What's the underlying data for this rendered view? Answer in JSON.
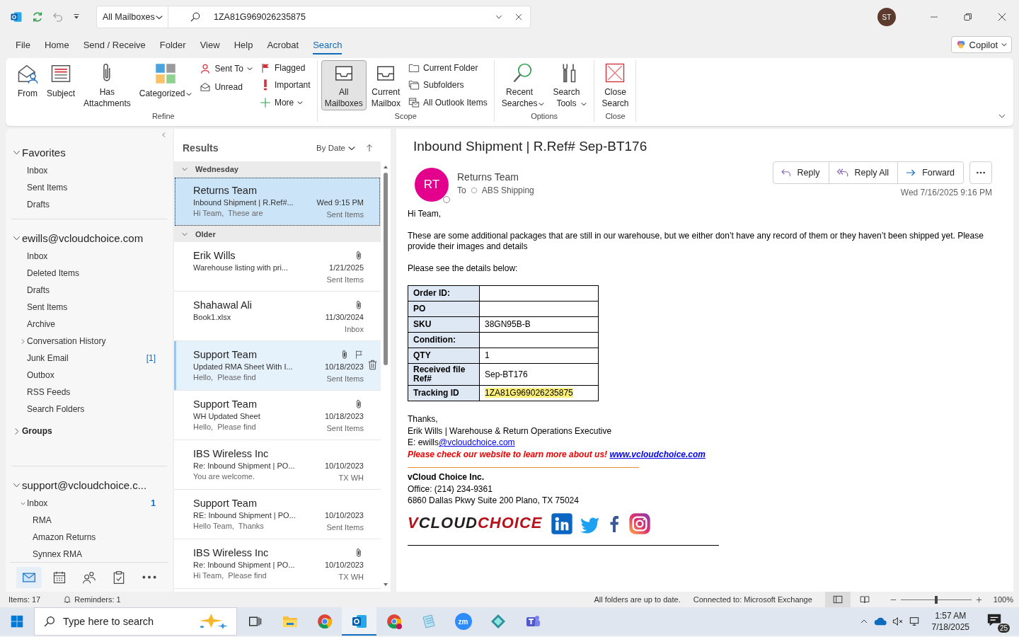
{
  "title_bar": {
    "scope": "All Mailboxes",
    "search": {
      "value": "1ZA81G969026235875"
    },
    "account_initials": "ST"
  },
  "menu_tabs": [
    {
      "label": "File",
      "selected": false
    },
    {
      "label": "Home",
      "selected": false
    },
    {
      "label": "Send / Receive",
      "selected": false
    },
    {
      "label": "Folder",
      "selected": false
    },
    {
      "label": "View",
      "selected": false
    },
    {
      "label": "Help",
      "selected": false
    },
    {
      "label": "Acrobat",
      "selected": false
    },
    {
      "label": "Search",
      "selected": true
    }
  ],
  "copilot": {
    "label": "Copilot"
  },
  "ribbon_groups": [
    {
      "label": "Refine",
      "columns": [
        {
          "kind": "large",
          "label": "From",
          "selected": false
        },
        {
          "kind": "large",
          "label": "Subject",
          "selected": false
        },
        {
          "kind": "large",
          "label": "Has Attachments",
          "selected": false
        },
        {
          "kind": "large",
          "label": "Categorized",
          "selected": false,
          "dropdown": true
        },
        {
          "kind": "stack",
          "buttons": [
            {
              "label": "Sent To",
              "dropdown": true
            },
            {
              "label": "Unread"
            }
          ]
        },
        {
          "kind": "stack",
          "buttons": [
            {
              "label": "Flagged"
            },
            {
              "label": "Important"
            },
            {
              "label": "More",
              "dropdown": true
            }
          ]
        }
      ]
    },
    {
      "label": "Scope",
      "columns": [
        {
          "kind": "large",
          "label": "All Mailboxes",
          "selected": true
        },
        {
          "kind": "large",
          "label": "Current Mailbox",
          "selected": false
        },
        {
          "kind": "stack",
          "buttons": [
            {
              "label": "Current Folder"
            },
            {
              "label": "Subfolders"
            },
            {
              "label": "All Outlook Items"
            }
          ]
        }
      ]
    },
    {
      "label": "Options",
      "columns": [
        {
          "kind": "large",
          "label": "Recent Searches",
          "selected": false,
          "dropdown": true
        },
        {
          "kind": "large",
          "label": "Search Tools",
          "selected": false,
          "dropdown": true
        }
      ]
    },
    {
      "label": "Close",
      "columns": [
        {
          "kind": "large",
          "label": "Close Search",
          "selected": false
        }
      ]
    }
  ],
  "nav": [
    {
      "kind": "account",
      "label": "Favorites",
      "expanded": true,
      "children": [
        {
          "label": "Inbox"
        },
        {
          "label": "Sent Items"
        },
        {
          "label": "Drafts"
        }
      ]
    },
    {
      "kind": "account",
      "label": "ewills@vcloudchoice.com",
      "expanded": true,
      "children": [
        {
          "label": "Inbox"
        },
        {
          "label": "Deleted Items"
        },
        {
          "label": "Drafts"
        },
        {
          "label": "Sent Items"
        },
        {
          "label": "Archive"
        },
        {
          "label": "Conversation History",
          "expanded": false
        },
        {
          "label": "Junk Email",
          "count": "[1]"
        },
        {
          "label": "Outbox"
        },
        {
          "label": "RSS Feeds"
        },
        {
          "label": "Search Folders"
        }
      ]
    },
    {
      "kind": "group",
      "label": "Groups",
      "expanded": false
    },
    {
      "kind": "account",
      "label": "support@vcloudchoice.c...",
      "expanded": true,
      "children": [
        {
          "label": "Inbox",
          "expanded": true,
          "count": "1",
          "children": [
            {
              "label": "RMA"
            },
            {
              "label": "Amazon Returns"
            },
            {
              "label": "Synnex RMA"
            }
          ]
        }
      ]
    }
  ],
  "module_switcher": [
    {
      "selected": true
    },
    {
      "selected": false
    },
    {
      "selected": false
    },
    {
      "selected": false
    },
    {
      "selected": false
    }
  ],
  "message_list": {
    "title": "Results",
    "sort": "By Date",
    "groups": [
      {
        "label": "Wednesday",
        "expanded": true,
        "messages": [
          {
            "sender": "Returns Team",
            "subject": "Inbound Shipment | R.Ref#...",
            "preview": "Hi Team,  These are",
            "date": "Wed 9:15 PM",
            "folder": "Sent Items",
            "attachment": false,
            "selected": true,
            "hovered": false
          }
        ]
      },
      {
        "label": "Older",
        "expanded": true,
        "messages": [
          {
            "sender": "Erik Wills",
            "subject": "Warehouse listing with pri...",
            "date": "1/21/2025",
            "folder": "Sent Items",
            "attachment": true,
            "selected": false,
            "hovered": false
          },
          {
            "sender": "Shahawal Ali",
            "subject": "Book1.xlsx",
            "date": "11/30/2024",
            "folder": "Inbox",
            "attachment": true,
            "selected": false,
            "hovered": false
          },
          {
            "sender": "Support Team",
            "subject": "Updated RMA Sheet With I...",
            "preview": "Hello,  Please find",
            "date": "10/18/2023",
            "folder": "Sent Items",
            "attachment": true,
            "selected": false,
            "hovered": true
          },
          {
            "sender": "Support Team",
            "subject": "WH Updated Sheet",
            "preview": "Hello,  Please find",
            "date": "10/18/2023",
            "folder": "Sent Items",
            "attachment": true,
            "selected": false,
            "hovered": false
          },
          {
            "sender": "IBS Wireless Inc",
            "subject": "Re: Inbound Shipment | PO...",
            "preview": "You are welcome.",
            "date": "10/10/2023",
            "folder": "TX WH",
            "attachment": false,
            "selected": false,
            "hovered": false
          },
          {
            "sender": "Support Team",
            "subject": "RE: Inbound Shipment | PO...",
            "preview": "Hello Team,  Thanks",
            "date": "10/10/2023",
            "folder": "Sent Items",
            "attachment": false,
            "selected": false,
            "hovered": false
          },
          {
            "sender": "IBS Wireless Inc",
            "subject": "Re: Inbound Shipment | PO...",
            "preview": "Hi Team,  Please find",
            "date": "10/10/2023",
            "folder": "TX WH",
            "attachment": true,
            "selected": false,
            "hovered": false
          }
        ]
      }
    ]
  },
  "reading_pane": {
    "subject": "Inbound Shipment | R.Ref# Sep-BT176",
    "sender_initials": "RT",
    "sender": "Returns Team",
    "to_label": "To",
    "recipient": "ABS Shipping",
    "actions": [
      {
        "label": "Reply"
      },
      {
        "label": "Reply All"
      },
      {
        "label": "Forward"
      }
    ],
    "date": "Wed 7/16/2025 9:16 PM",
    "body": {
      "greeting": "Hi Team,",
      "paragraph": "These are some additional packages that are still in our warehouse, but we either don’t have any record of them or they haven’t been shipped yet. Please provide their images and details",
      "intro": "Please see the details below:",
      "table": [
        {
          "label": "Order ID:",
          "highlighted": false
        },
        {
          "label": "PO",
          "highlighted": false
        },
        {
          "label": "SKU",
          "value": "38GN95B-B",
          "highlighted": false
        },
        {
          "label": "Condition:",
          "highlighted": false
        },
        {
          "label": "QTY",
          "value": "1",
          "highlighted": false
        },
        {
          "label": "Received file Ref#",
          "value": "Sep-BT176",
          "highlighted": false
        },
        {
          "label": "Tracking ID",
          "value": "1ZA81G969026235875",
          "highlighted": true
        }
      ],
      "signoff": "Thanks,",
      "signature_name": "Erik Wills | Warehouse & Return Operations Executive",
      "email_prefix": "E: ewills",
      "email_link": "@vcloudchoice.com",
      "promo": "Please check our website to learn more about us!",
      "website": "www.vcloudchoice.com",
      "company": "vCloud Choice Inc.",
      "office": "Office: (214) 234-9361",
      "address": "6860 Dallas Pkwy Suite 200 Plano, TX 75024",
      "logo": [
        {
          "text": "V",
          "color": "#b5121b"
        },
        {
          "text": "CLOUD",
          "color": "#231f20"
        },
        {
          "text": "CHOICE",
          "color": "#b5121b"
        }
      ]
    }
  },
  "status_bar": {
    "items": "Items: 17",
    "reminders": "Reminders: 1",
    "sync": "All folders are up to date.",
    "connection": "Connected to: Microsoft Exchange",
    "zoom": {
      "level": 0.5,
      "reading": "100%"
    }
  },
  "taskbar": {
    "search_placeholder": "Type here to search",
    "apps": [
      {
        "selected": false
      },
      {
        "selected": false
      },
      {
        "selected": true
      },
      {
        "selected": false
      },
      {
        "selected": false
      },
      {
        "selected": false,
        "glyph": "zm"
      },
      {
        "selected": false
      },
      {
        "selected": false
      }
    ],
    "time": "1:57 AM",
    "date": "7/18/2025",
    "notifications": "25"
  }
}
